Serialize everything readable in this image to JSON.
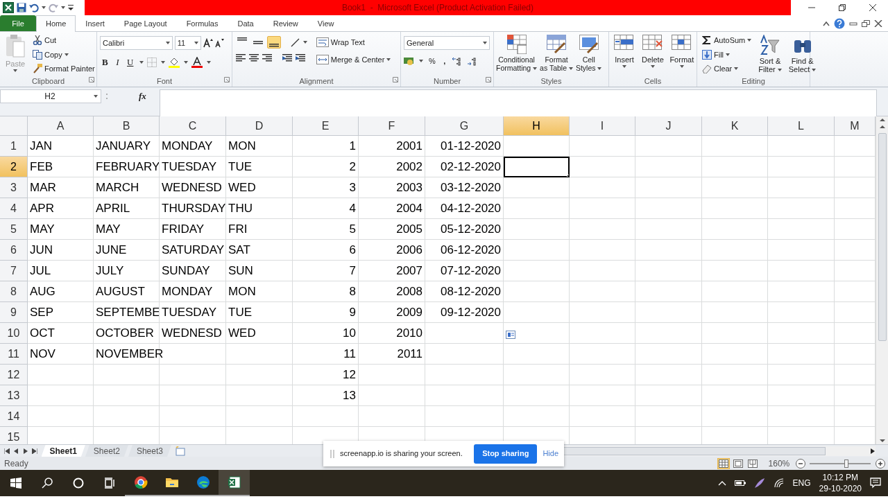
{
  "title_bar": {
    "title": "Book1  -  Microsoft Excel (Product Activation Failed)"
  },
  "ribbon_tabs": [
    {
      "label": "File",
      "kind": "file",
      "selected": false
    },
    {
      "label": "Home",
      "kind": "tab",
      "selected": true
    },
    {
      "label": "Insert",
      "kind": "tab",
      "selected": false
    },
    {
      "label": "Page Layout",
      "kind": "tab",
      "selected": false
    },
    {
      "label": "Formulas",
      "kind": "tab",
      "selected": false
    },
    {
      "label": "Data",
      "kind": "tab",
      "selected": false
    },
    {
      "label": "Review",
      "kind": "tab",
      "selected": false
    },
    {
      "label": "View",
      "kind": "tab",
      "selected": false
    }
  ],
  "ribbon_groups": [
    {
      "kind": "clipboard",
      "label": "Clipboard",
      "paste": {
        "label": "Paste",
        "disabled": true
      },
      "buttons": [
        "Cut",
        "Copy",
        "Format Painter"
      ]
    },
    {
      "kind": "font",
      "label": "Font",
      "font_name": "Calibri",
      "font_size": "11",
      "bold": "B",
      "italic": "I",
      "underline": "U"
    },
    {
      "kind": "alignment",
      "label": "Alignment",
      "vertical_align": [
        {
          "selected": false
        },
        {
          "selected": false
        },
        {
          "selected": true
        }
      ],
      "wrap": "Wrap Text",
      "merge": "Merge & Center"
    },
    {
      "kind": "number",
      "label": "Number",
      "format": "General",
      "percent": "%",
      "comma": ","
    },
    {
      "kind": "styles",
      "label": "Styles",
      "buttons": [
        [
          "Conditional",
          "Formatting"
        ],
        [
          "Format",
          "as Table"
        ],
        [
          "Cell",
          "Styles"
        ]
      ]
    },
    {
      "kind": "cells",
      "label": "Cells",
      "buttons": [
        "Insert",
        "Delete",
        "Format"
      ]
    },
    {
      "kind": "editing",
      "label": "Editing",
      "small": [
        "AutoSum",
        "Fill",
        "Clear"
      ],
      "large": [
        [
          "Sort &",
          "Filter"
        ],
        [
          "Find &",
          "Select"
        ]
      ]
    }
  ],
  "formula_bar": {
    "name_box": "H2",
    "function_label": "fx"
  },
  "sheet": {
    "columns": [
      {
        "label": "A",
        "right_aligned": false,
        "selected": false
      },
      {
        "label": "B",
        "right_aligned": false,
        "selected": false
      },
      {
        "label": "C",
        "right_aligned": false,
        "selected": false
      },
      {
        "label": "D",
        "right_aligned": false,
        "selected": false
      },
      {
        "label": "E",
        "right_aligned": true,
        "selected": false
      },
      {
        "label": "F",
        "right_aligned": true,
        "selected": false
      },
      {
        "label": "G",
        "right_aligned": true,
        "selected": false
      },
      {
        "label": "H",
        "selected": true
      },
      {
        "label": "I",
        "selected": false
      },
      {
        "label": "J",
        "selected": false
      },
      {
        "label": "K",
        "selected": false
      },
      {
        "label": "L",
        "selected": false
      },
      {
        "label": "M",
        "selected": false
      }
    ],
    "rows": [
      {
        "label": "1",
        "selected": false,
        "cells": [
          "JAN",
          "JANUARY",
          "MONDAY",
          "MON",
          "1",
          "2001",
          "01-12-2020",
          null,
          null,
          null,
          null,
          null,
          null
        ]
      },
      {
        "label": "2",
        "selected": true,
        "cells": [
          "FEB",
          "FEBRUARY",
          "TUESDAY",
          "TUE",
          "2",
          "2002",
          "02-12-2020",
          null,
          null,
          null,
          null,
          null,
          null
        ]
      },
      {
        "label": "3",
        "selected": false,
        "cells": [
          "MAR",
          "MARCH",
          "WEDNESD",
          "WED",
          "3",
          "2003",
          "03-12-2020",
          null,
          null,
          null,
          null,
          null,
          null
        ]
      },
      {
        "label": "4",
        "selected": false,
        "cells": [
          "APR",
          "APRIL",
          "THURSDAY",
          "THU",
          "4",
          "2004",
          "04-12-2020",
          null,
          null,
          null,
          null,
          null,
          null
        ]
      },
      {
        "label": "5",
        "selected": false,
        "cells": [
          "MAY",
          "MAY",
          "FRIDAY",
          "FRI",
          "5",
          "2005",
          "05-12-2020",
          null,
          null,
          null,
          null,
          null,
          null
        ]
      },
      {
        "label": "6",
        "selected": false,
        "cells": [
          "JUN",
          "JUNE",
          "SATURDAY",
          "SAT",
          "6",
          "2006",
          "06-12-2020",
          null,
          null,
          null,
          null,
          null,
          null
        ]
      },
      {
        "label": "7",
        "selected": false,
        "cells": [
          "JUL",
          "JULY",
          "SUNDAY",
          "SUN",
          "7",
          "2007",
          "07-12-2020",
          null,
          null,
          null,
          null,
          null,
          null
        ]
      },
      {
        "label": "8",
        "selected": false,
        "cells": [
          "AUG",
          "AUGUST",
          "MONDAY",
          "MON",
          "8",
          "2008",
          "08-12-2020",
          null,
          null,
          null,
          null,
          null,
          null
        ]
      },
      {
        "label": "9",
        "selected": false,
        "cells": [
          "SEP",
          "SEPTEMBE",
          "TUESDAY",
          "TUE",
          "9",
          "2009",
          "09-12-2020",
          null,
          null,
          null,
          null,
          null,
          null
        ]
      },
      {
        "label": "10",
        "selected": false,
        "cells": [
          "OCT",
          "OCTOBER",
          "WEDNESD",
          "WED",
          "10",
          "2010",
          null,
          null,
          null,
          null,
          null,
          null,
          null
        ]
      },
      {
        "label": "11",
        "selected": false,
        "cells": [
          "NOV",
          "NOVEMBER",
          null,
          null,
          "11",
          "2011",
          null,
          null,
          null,
          null,
          null,
          null,
          null
        ]
      },
      {
        "label": "12",
        "selected": false,
        "cells": [
          null,
          null,
          null,
          null,
          "12",
          null,
          null,
          null,
          null,
          null,
          null,
          null,
          null
        ]
      },
      {
        "label": "13",
        "selected": false,
        "cells": [
          null,
          null,
          null,
          null,
          "13",
          null,
          null,
          null,
          null,
          null,
          null,
          null,
          null
        ]
      },
      {
        "label": "14",
        "selected": false,
        "cells": [
          null,
          null,
          null,
          null,
          null,
          null,
          null,
          null,
          null,
          null,
          null,
          null,
          null
        ]
      },
      {
        "label": "15",
        "selected": false,
        "cells": [
          null,
          null,
          null,
          null,
          null,
          null,
          null,
          null,
          null,
          null,
          null,
          null,
          null
        ]
      }
    ]
  },
  "sheet_tabs": [
    {
      "label": "Sheet1",
      "selected": true
    },
    {
      "label": "Sheet2",
      "selected": false
    },
    {
      "label": "Sheet3",
      "selected": false
    }
  ],
  "status_bar": {
    "text": "Ready",
    "views": [
      {
        "kind": "normal",
        "selected": true
      },
      {
        "kind": "page_layout",
        "selected": false
      },
      {
        "kind": "page_break",
        "selected": false
      }
    ],
    "zoom": "160%",
    "zoom_slider": {
      "level": 0.6
    }
  },
  "share_bar": {
    "message": "screenapp.io is sharing your screen.",
    "stop": "Stop sharing",
    "hide": "Hide"
  },
  "taskbar": {
    "apps": [
      {
        "kind": "chrome",
        "active": false
      },
      {
        "kind": "explorer",
        "active": false
      },
      {
        "kind": "edge",
        "active": false
      },
      {
        "kind": "excel",
        "active": true
      }
    ],
    "language": "ENG",
    "time": "10:12 PM",
    "date": "29-10-2020"
  }
}
